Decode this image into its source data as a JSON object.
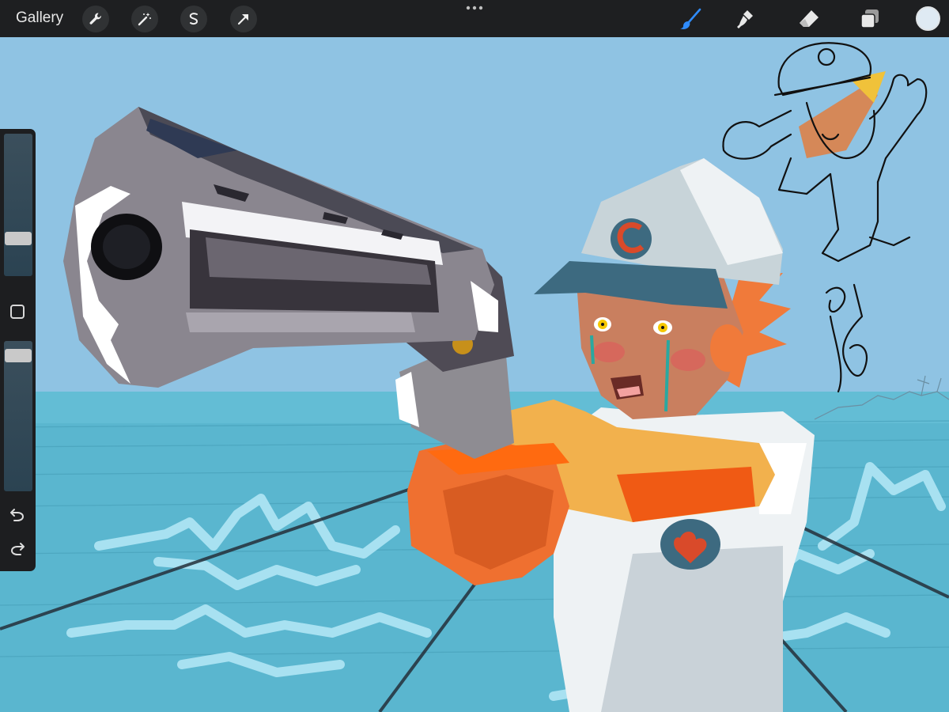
{
  "toolbar": {
    "gallery_label": "Gallery",
    "left_tools": [
      {
        "name": "wrench-icon",
        "action": "actions"
      },
      {
        "name": "magic-wand-icon",
        "action": "adjustments"
      },
      {
        "name": "selection-icon",
        "action": "selection"
      },
      {
        "name": "arrow-icon",
        "action": "transform"
      }
    ],
    "right_tools": [
      {
        "name": "brush-icon",
        "active": true
      },
      {
        "name": "smudge-icon",
        "active": false
      },
      {
        "name": "eraser-icon",
        "active": false
      },
      {
        "name": "layers-icon",
        "active": false
      }
    ],
    "current_color": "#dfeaf3",
    "active_tool_color": "#2f8cff"
  },
  "sidebar": {
    "brush_size_level": 0.72,
    "opacity_level": 0.83,
    "undo_icon": "undo-icon",
    "redo_icon": "redo-icon"
  },
  "canvas": {
    "artwork": "illustration-character-with-revolver",
    "sky_color": "#8fc3e3",
    "sea_color": "#5ab6cf"
  }
}
